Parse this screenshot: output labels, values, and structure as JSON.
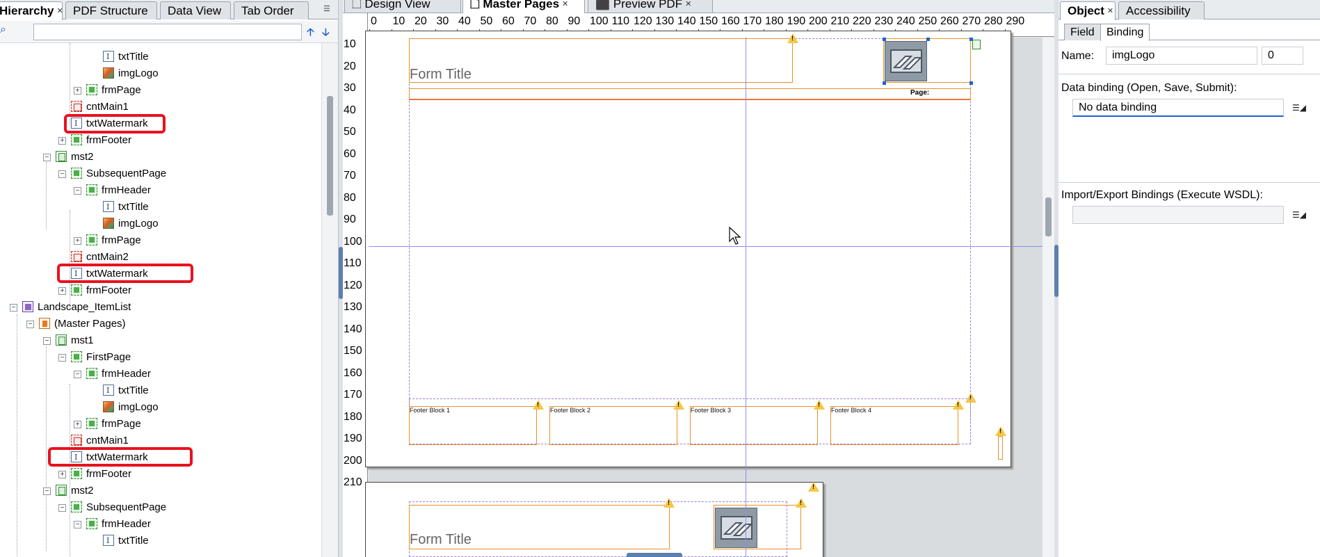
{
  "left": {
    "tabs": [
      "Hierarchy",
      "PDF Structure",
      "Data View",
      "Tab Order"
    ],
    "search_placeholder": "",
    "tree": [
      {
        "label": "txtTitle",
        "icon": "text-field-icon",
        "expander": ""
      },
      {
        "label": "imgLogo",
        "icon": "image-icon",
        "expander": ""
      },
      {
        "label": "frmPage",
        "icon": "subform-icon",
        "expander": "+"
      },
      {
        "label": "cntMain1",
        "icon": "content-area-icon",
        "expander": ""
      },
      {
        "label": "txtWatermark",
        "icon": "text-field-icon",
        "expander": "",
        "highlighted": true
      },
      {
        "label": "frmFooter",
        "icon": "subform-icon",
        "expander": "+"
      },
      {
        "label": "mst2",
        "icon": "master-page-icon",
        "expander": "−"
      },
      {
        "label": "SubsequentPage",
        "icon": "subform-icon",
        "expander": "−"
      },
      {
        "label": "frmHeader",
        "icon": "subform-icon",
        "expander": "−"
      },
      {
        "label": "txtTitle",
        "icon": "text-field-icon",
        "expander": ""
      },
      {
        "label": "imgLogo",
        "icon": "image-icon",
        "expander": ""
      },
      {
        "label": "frmPage",
        "icon": "subform-icon",
        "expander": "+"
      },
      {
        "label": "cntMain2",
        "icon": "content-area-icon",
        "expander": ""
      },
      {
        "label": "txtWatermark",
        "icon": "text-field-icon",
        "expander": "",
        "highlighted": true
      },
      {
        "label": "frmFooter",
        "icon": "subform-icon",
        "expander": "+"
      },
      {
        "label": "Landscape_ItemList",
        "icon": "form-icon",
        "expander": "−"
      },
      {
        "label": "(Master Pages)",
        "icon": "master-pages-icon",
        "expander": "−"
      },
      {
        "label": "mst1",
        "icon": "master-page-icon",
        "expander": "−"
      },
      {
        "label": "FirstPage",
        "icon": "subform-icon",
        "expander": "−"
      },
      {
        "label": "frmHeader",
        "icon": "subform-icon",
        "expander": "−"
      },
      {
        "label": "txtTitle",
        "icon": "text-field-icon",
        "expander": ""
      },
      {
        "label": "imgLogo",
        "icon": "image-icon",
        "expander": ""
      },
      {
        "label": "frmPage",
        "icon": "subform-icon",
        "expander": "+"
      },
      {
        "label": "cntMain1",
        "icon": "content-area-icon",
        "expander": ""
      },
      {
        "label": "txtWatermark",
        "icon": "text-field-icon",
        "expander": "",
        "highlighted": true
      },
      {
        "label": "frmFooter",
        "icon": "subform-icon",
        "expander": "+"
      },
      {
        "label": "mst2",
        "icon": "master-page-icon",
        "expander": "−"
      },
      {
        "label": "SubsequentPage",
        "icon": "subform-icon",
        "expander": "−"
      },
      {
        "label": "frmHeader",
        "icon": "subform-icon",
        "expander": "−"
      },
      {
        "label": "txtTitle",
        "icon": "text-field-icon",
        "expander": ""
      }
    ]
  },
  "center": {
    "tabs": [
      "Design View",
      "Master Pages",
      "Preview PDF"
    ],
    "ruler_h": [
      "0",
      "10",
      "20",
      "30",
      "40",
      "50",
      "60",
      "70",
      "80",
      "90",
      "100",
      "110",
      "120",
      "130",
      "140",
      "150",
      "160",
      "170",
      "180",
      "190",
      "200",
      "210",
      "220",
      "230",
      "240",
      "250",
      "260",
      "270",
      "280",
      "290"
    ],
    "ruler_v": [
      "10",
      "20",
      "30",
      "40",
      "50",
      "60",
      "70",
      "80",
      "90",
      "100",
      "110",
      "120",
      "130",
      "140",
      "150",
      "160",
      "170",
      "180",
      "190",
      "200",
      "210"
    ],
    "page1": {
      "form_title": "Form Title",
      "page_label": "Page:",
      "footer_blocks": [
        "Footer Block 1",
        "Footer Block 2",
        "Footer Block 3",
        "Footer Block 4"
      ]
    },
    "page2": {
      "form_title": "Form Title"
    }
  },
  "right": {
    "tabs": [
      "Object",
      "Accessibility"
    ],
    "subtabs": [
      "Field",
      "Binding"
    ],
    "name_label": "Name:",
    "name_value": "imgLogo",
    "name_index": "0",
    "data_binding_label": "Data binding (Open, Save, Submit):",
    "data_binding_value": "No data binding",
    "import_export_label": "Import/Export Bindings (Execute WSDL):",
    "import_export_value": ""
  },
  "colors": {
    "accent_blue": "#1e63d6",
    "highlight_red": "#e8121e",
    "object_orange": "#e88f2a",
    "warning_yellow": "#f6c744"
  }
}
